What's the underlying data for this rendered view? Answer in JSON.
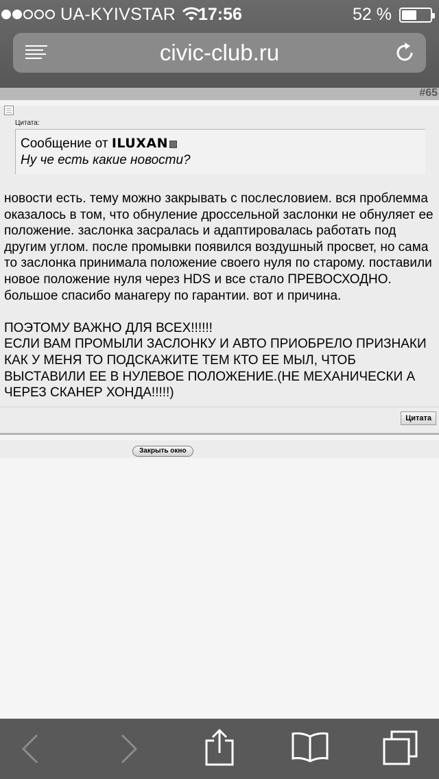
{
  "status_bar": {
    "carrier": "UA-KYIVSTAR",
    "signal_strength": 2,
    "signal_max": 5,
    "time": "17:56",
    "battery_percent": "52 %",
    "battery_level": 0.52
  },
  "address_bar": {
    "url": "civic-club.ru"
  },
  "post": {
    "number": "#65",
    "quote_label": "Цитата:",
    "quote_prefix": "Сообщение от ",
    "quote_author": "ILUXAN",
    "quote_text": "Ну че есть какие новости?",
    "text": "новости есть. тему можно закрывать с послесловием. вся проблемма оказалось в том, что обнуление дроссельной заслонки не обнуляет ее положение. заслонка засралась и адаптировалась работать под другим углом. после промывки появился воздушный просвет, но сама то заслонка принимала положение своего нуля по старому. поставили новое положение нуля через HDS и все стало ПРЕВОСХОДНО. большое спасибо манагеру по гарантии. вот и причина.\n\nПОЭТОМУ ВАЖНО ДЛЯ ВСЕХ!!!!!!\nЕСЛИ ВАМ ПРОМЫЛИ ЗАСЛОНКУ И АВТО ПРИОБРЕЛО ПРИЗНАКИ КАК У МЕНЯ ТО ПОДСКАЖИТЕ ТЕМ КТО ЕЕ МЫЛ, ЧТОБ ВЫСТАВИЛИ ЕЕ В НУЛЕВОЕ ПОЛОЖЕНИЕ.(НЕ МЕХАНИЧЕСКИ А ЧЕРЕЗ СКАНЕР ХОНДА!!!!!)",
    "quote_button_label": "Цитата"
  },
  "close_window_label": "Закрыть окно",
  "colors": {
    "chrome": "#595959",
    "address_bar": "#8a8a8a",
    "post_header": "#b8b8b8",
    "post_bg": "#ececec"
  },
  "toolbar_icons": [
    "back-icon",
    "forward-icon",
    "share-icon",
    "bookmarks-icon",
    "tabs-icon"
  ]
}
